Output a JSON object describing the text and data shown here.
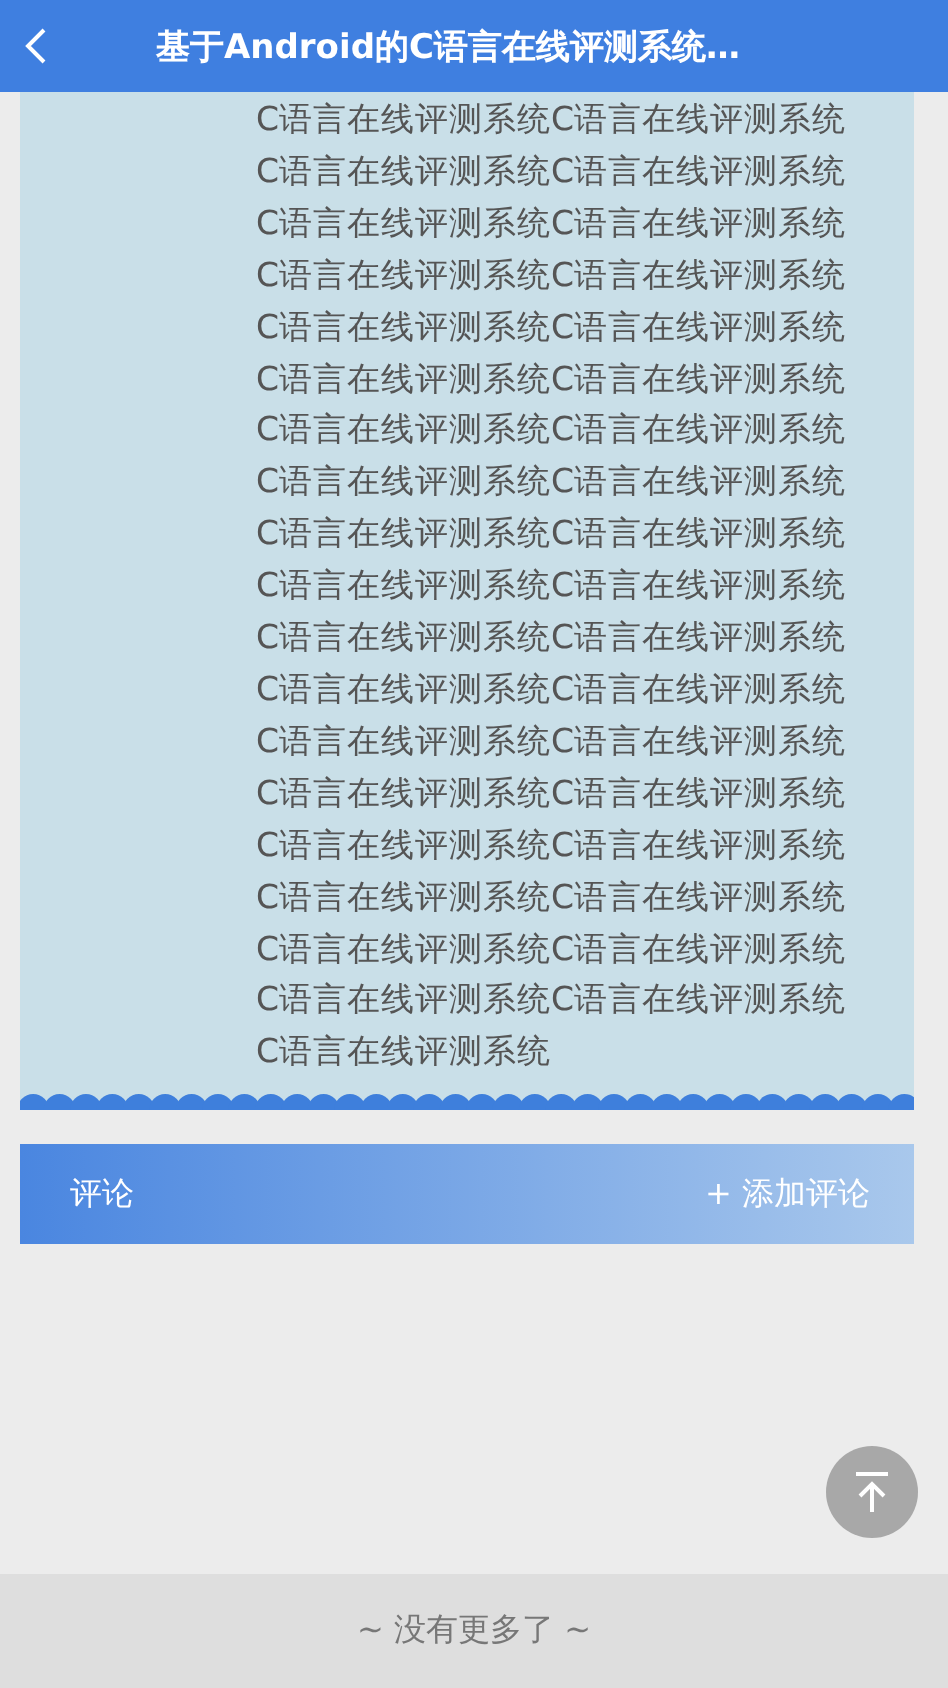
{
  "header": {
    "title": "基于Android的C语言在线评测系统…"
  },
  "article": {
    "body": "C语言在线评测系统C语言在线评测系统C语言在线评测系统C语言在线评测系统C语言在线评测系统C语言在线评测系统C语言在线评测系统C语言在线评测系统C语言在线评测系统C语言在线评测系统C语言在线评测系统C语言在线评测系统C语言在线评测系统C语言在线评测系统C语言在线评测系统C语言在线评测系统C语言在线评测系统C语言在线评测系统C语言在线评测系统C语言在线评测系统C语言在线评测系统C语言在线评测系统C语言在线评测系统C语言在线评测系统C语言在线评测系统C语言在线评测系统C语言在线评测系统C语言在线评测系统C语言在线评测系统C语言在线评测系统C语言在线评测系统C语言在线评测系统C语言在线评测系统C语言在线评测系统C语言在线评测系统C语言在线评测系统C语言在线评测系统"
  },
  "comments": {
    "title": "评论",
    "add_button": "+ 添加评论"
  },
  "footer": {
    "text": "~ 没有更多了 ~"
  }
}
